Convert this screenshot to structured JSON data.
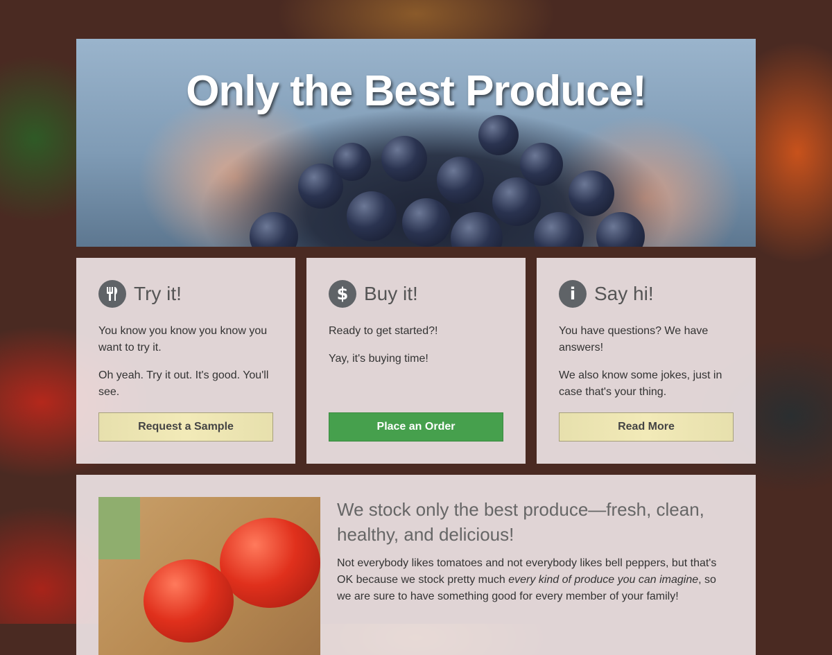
{
  "hero": {
    "title": "Only the Best Produce!"
  },
  "cards": [
    {
      "icon": "fork-knife-icon",
      "title": "Try it!",
      "paragraphs": [
        "You know you know you know you want to try it.",
        "Oh yeah. Try it out. It's good. You'll see."
      ],
      "button_label": "Request a Sample"
    },
    {
      "icon": "dollar-icon",
      "title": "Buy it!",
      "paragraphs": [
        "Ready to get started?!",
        "Yay, it's buying time!"
      ],
      "button_label": "Place an Order"
    },
    {
      "icon": "info-icon",
      "title": "Say hi!",
      "paragraphs": [
        "You have questions? We have answers!",
        "We also know some jokes, just in case that's your thing."
      ],
      "button_label": "Read More"
    }
  ],
  "feature": {
    "heading": "We stock only the best produce—fresh, clean, healthy, and delicious!",
    "body_before": "Not everybody likes tomatoes and not everybody likes bell peppers, but that's OK because we stock pretty much ",
    "body_emphasis": "every kind of produce you can imagine",
    "body_after": ", so we are sure to have something good for every member of your family!"
  },
  "colors": {
    "button_cream": "#f2eab8",
    "button_green": "#46a04d",
    "icon_circle": "#5f6367"
  }
}
